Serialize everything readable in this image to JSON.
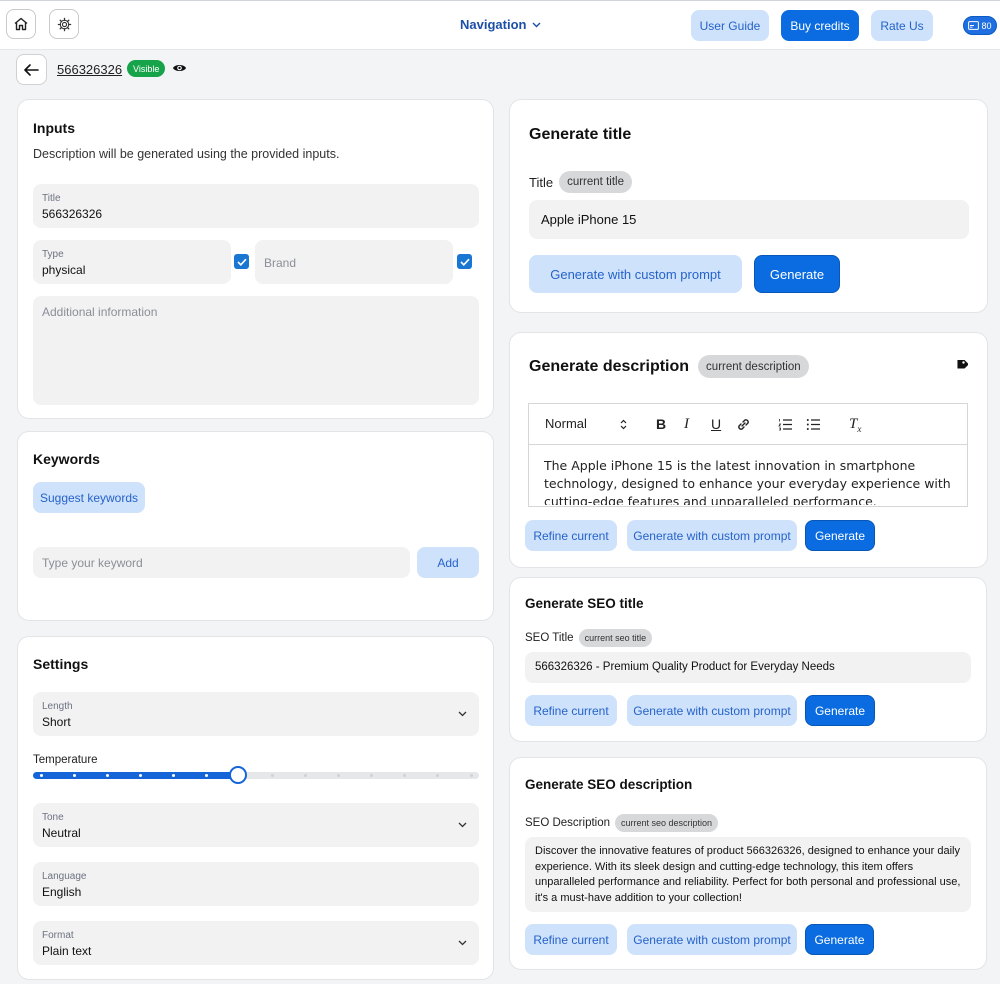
{
  "topbar": {
    "navigation_label": "Navigation",
    "user_guide": "User Guide",
    "buy_credits": "Buy credits",
    "rate_us": "Rate Us",
    "credits_count": "80"
  },
  "product": {
    "id": "566326326",
    "visibility": "Visible"
  },
  "inputs": {
    "title": "Inputs",
    "description": "Description will be generated using the provided inputs.",
    "title_label": "Title",
    "title_value": "566326326",
    "type_label": "Type",
    "type_value": "physical",
    "brand_placeholder": "Brand",
    "additional_placeholder": "Additional information"
  },
  "keywords": {
    "title": "Keywords",
    "suggest": "Suggest keywords",
    "input_placeholder": "Type your keyword",
    "add": "Add"
  },
  "settings": {
    "title": "Settings",
    "length_label": "Length",
    "length_value": "Short",
    "temperature_label": "Temperature",
    "temperature_level": 0.46,
    "tone_label": "Tone",
    "tone_value": "Neutral",
    "language_label": "Language",
    "language_value": "English",
    "format_label": "Format",
    "format_value": "Plain text"
  },
  "gen_title": {
    "heading": "Generate title",
    "field_label": "Title",
    "tag": "current title",
    "value": "Apple iPhone 15",
    "custom": "Generate with custom prompt",
    "generate": "Generate"
  },
  "gen_desc": {
    "heading": "Generate description",
    "tag": "current description",
    "format_select": "Normal",
    "text": "The Apple iPhone 15 is the latest innovation in smartphone technology, designed to enhance your everyday experience with cutting-edge features and unparalleled performance.",
    "refine": "Refine current",
    "custom": "Generate with custom prompt",
    "generate": "Generate"
  },
  "seo_title": {
    "heading": "Generate SEO title",
    "field_label": "SEO Title",
    "tag": "current seo title",
    "value": "566326326 - Premium Quality Product for Everyday Needs",
    "refine": "Refine current",
    "custom": "Generate with custom prompt",
    "generate": "Generate"
  },
  "seo_desc": {
    "heading": "Generate SEO description",
    "field_label": "SEO Description",
    "tag": "current seo description",
    "value": "Discover the innovative features of product 566326326, designed to enhance your daily experience. With its sleek design and cutting-edge technology, this item offers unparalleled performance and reliability. Perfect for both personal and professional use, it's a must-have addition to your collection!",
    "refine": "Refine current",
    "custom": "Generate with custom prompt",
    "generate": "Generate"
  },
  "colors": {
    "primary": "#0a6ce0",
    "light": "#cfe2fb",
    "visible_badge": "#16a34a"
  }
}
